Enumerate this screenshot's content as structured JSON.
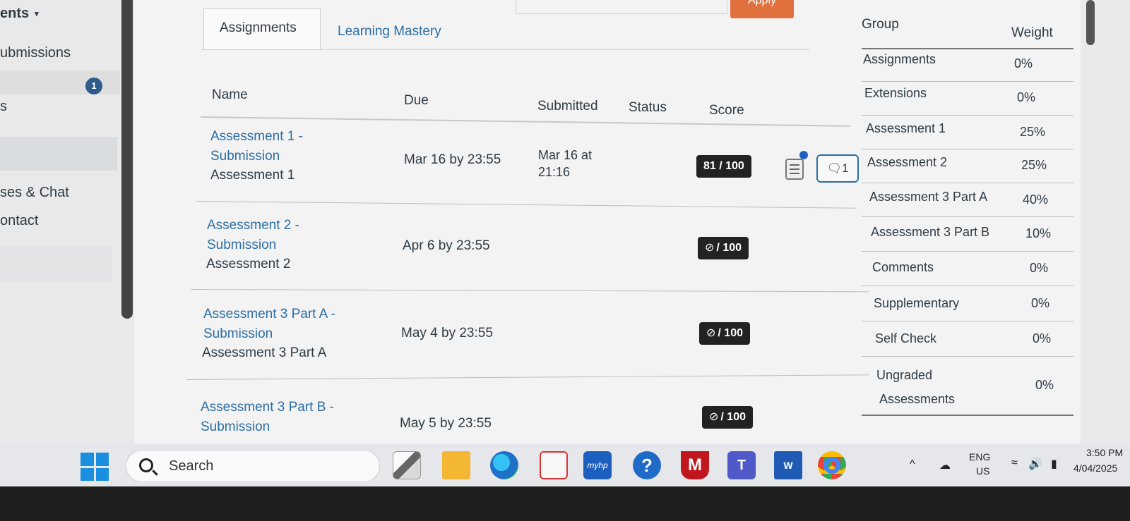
{
  "nav": {
    "title": "ents",
    "caret": "▾",
    "submissions": "ubmissions",
    "badge": "1",
    "s_item": "s",
    "chat": "ses & Chat",
    "contact": "ontact"
  },
  "apply": "Apply",
  "tabs": {
    "assignments": "Assignments",
    "mastery": "Learning Mastery"
  },
  "table_headers": {
    "name": "Name",
    "due": "Due",
    "submitted": "Submitted",
    "status": "Status",
    "score": "Score"
  },
  "rows": [
    {
      "name_line1": "Assessment 1 -",
      "name_line2": "Submission",
      "group": "Assessment 1",
      "due": "Mar 16 by 23:55",
      "submitted_line1": "Mar 16 at",
      "submitted_line2": "21:16",
      "score": "81 / 100",
      "comments": "1"
    },
    {
      "name_line1": "Assessment 2 -",
      "name_line2": "Submission",
      "group": "Assessment 2",
      "due": "Apr 6 by 23:55",
      "score": "/ 100"
    },
    {
      "name_line1": "Assessment 3 Part A -",
      "name_line2": "Submission",
      "group": "Assessment 3 Part A",
      "due": "May 4 by 23:55",
      "score": "/ 100"
    },
    {
      "name_line1": "Assessment 3 Part B -",
      "name_line2": "Submission",
      "due": "May 5 by 23:55",
      "score": "/ 100"
    }
  ],
  "weights": {
    "header_group": "Group",
    "header_weight": "Weight",
    "items": [
      {
        "group": "Assignments",
        "weight": "0%"
      },
      {
        "group": "Extensions",
        "weight": "0%"
      },
      {
        "group": "Assessment 1",
        "weight": "25%"
      },
      {
        "group": "Assessment 2",
        "weight": "25%"
      },
      {
        "group": "Assessment 3 Part A",
        "weight": "40%"
      },
      {
        "group": "Assessment 3 Part B",
        "weight": "10%"
      },
      {
        "group": "Comments",
        "weight": "0%"
      },
      {
        "group": "Supplementary",
        "weight": "0%"
      },
      {
        "group": "Self Check",
        "weight": "0%"
      },
      {
        "group": "Ungraded",
        "group_line2": "Assessments",
        "weight": "0%"
      }
    ]
  },
  "taskbar": {
    "search_placeholder": "Search",
    "apps": [
      "file-explorer-icon",
      "folder-icon",
      "edge-icon",
      "store-icon",
      "myhp-icon",
      "help-icon",
      "mcafee-icon",
      "teams-icon",
      "word-icon",
      "chrome-icon"
    ],
    "myhp_label": "myhp",
    "help_label": "?",
    "mcafee_label": "M",
    "teams_label": "T",
    "word_label": "W",
    "lang_top": "ENG",
    "lang_bottom": "US",
    "time": "3:50 PM",
    "date": "4/04/2025",
    "chevron": "^"
  },
  "colors": {
    "link": "#2b6ea5",
    "apply": "#e0703e",
    "score_pill": "#222222",
    "badge": "#2d5b8a"
  }
}
